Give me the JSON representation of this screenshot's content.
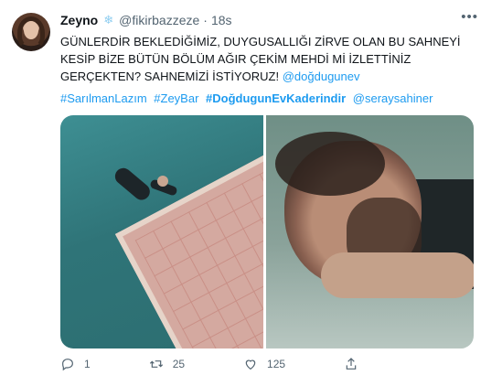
{
  "tweet": {
    "author": {
      "name": "Zeyno",
      "emoji": "❄",
      "handle": "@fikirbazzeze",
      "time": "18s"
    },
    "text_lines": [
      "GÜNLERDİR BEKLEDİĞİMİZ, DUYGUSALLIĞI ZİRVE OLAN BU SAHNEYİ",
      "KESİP BİZE BÜTÜN BÖLÜM AĞIR ÇEKİM MEHDİ Mİ İZLETTİNİZ",
      "GERÇEKTEN? SAHNEMİZİ İSTİYORUZ!"
    ],
    "mention": "@doğdugunev",
    "hashtags": [
      "#SarılmanLazım",
      "#ZeyBar",
      "#DoğdugunEvKaderindir",
      "@seraysahiner"
    ],
    "media": {
      "left_alt": "pool-scene",
      "right_alt": "man-lying-scene"
    },
    "actions": {
      "reply_count": "1",
      "retweet_count": "25",
      "like_count": "125"
    }
  },
  "icons": {
    "more": "more-icon",
    "reply": "reply-icon",
    "retweet": "retweet-icon",
    "like": "heart-icon",
    "share": "share-icon"
  },
  "colors": {
    "link": "#1d9bf0",
    "secondary_text": "#536471"
  }
}
